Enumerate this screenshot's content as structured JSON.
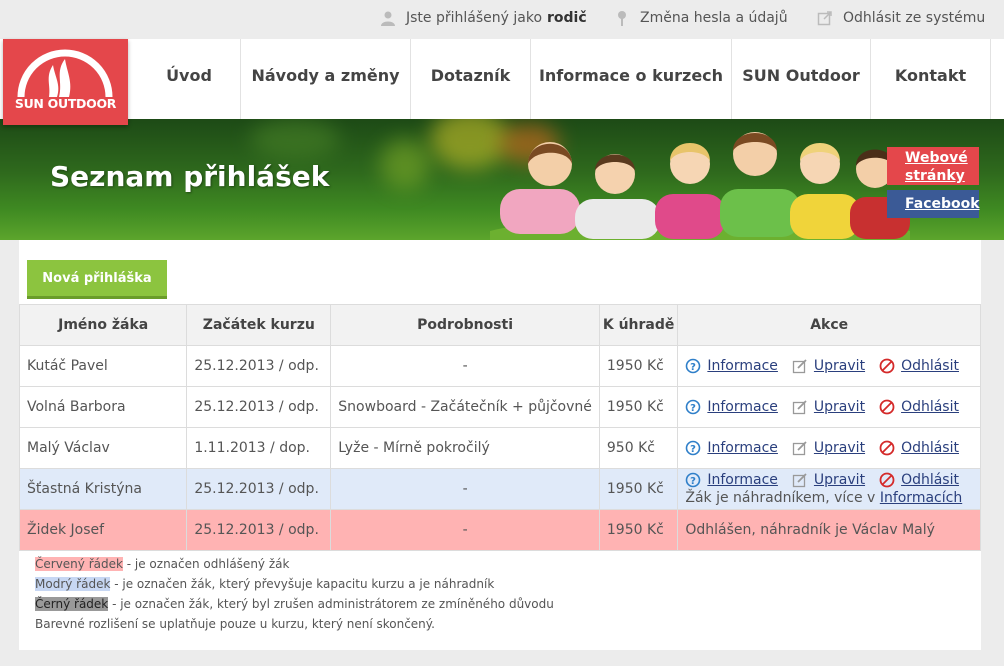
{
  "userbar": {
    "logged_as": "Jste přihlášený jako",
    "role": "rodič",
    "change_pw": "Změna hesla a údajů",
    "logout": "Odhlásit ze systému"
  },
  "logo": {
    "text": "SUN OUTDOOR"
  },
  "menu": [
    {
      "label": "Úvod"
    },
    {
      "label": "Návody a změny"
    },
    {
      "label": "Dotazník"
    },
    {
      "label": "Informace o kurzech"
    },
    {
      "label": "SUN Outdoor"
    },
    {
      "label": "Kontakt"
    }
  ],
  "banner": {
    "title": "Seznam přihlášek",
    "web_link": "Webové stránky",
    "fb_link": "Facebook"
  },
  "new_button": "Nová přihláška",
  "table": {
    "headers": [
      "Jméno žáka",
      "Začátek kurzu",
      "Podrobnosti",
      "K úhradě",
      "Akce"
    ],
    "rows": [
      {
        "name": "Kutáč Pavel",
        "start": "25.12.2013 / odp.",
        "details": "-",
        "due": "1950 Kč"
      },
      {
        "name": "Volná Barbora",
        "start": "25.12.2013 / odp.",
        "details": "Snowboard - Začátečník + půjčovné",
        "due": "1950 Kč"
      },
      {
        "name": "Malý Václav",
        "start": "1.11.2013 / dop.",
        "details": "Lyže - Mírně pokročilý",
        "due": "950 Kč"
      },
      {
        "name": "Šťastná Kristýna",
        "start": "25.12.2013 / odp.",
        "details": "-",
        "due": "1950 Kč",
        "note": "Žák je náhradníkem, více v",
        "note_link": "Informacích"
      },
      {
        "name": "Židek Josef",
        "start": "25.12.2013 / odp.",
        "details": "-",
        "due": "1950 Kč",
        "status": "Odhlášen, náhradník je Václav Malý"
      }
    ],
    "actions": {
      "info": "Informace",
      "edit": "Upravit",
      "cancel": "Odhlásit"
    }
  },
  "legend": {
    "red_label": "Červený řádek",
    "red_text": " - je označen odhlášený žák",
    "blue_label": "Modrý řádek",
    "blue_text": " - je označen žák, který převyšuje kapacitu kurzu a je náhradník",
    "black_label": "Černý řádek",
    "black_text": " - je označen žák, který byl zrušen administrátorem ze zmíněného důvodu",
    "footer": "Barevné rozlišení se uplatňuje pouze u kurzu, který není skončený."
  },
  "colors": {
    "brand_red": "#e4474b",
    "accent_green": "#8cc43f",
    "facebook_blue": "#3b5a96",
    "row_blue": "#e0eaf9",
    "row_red": "#ffb3b3"
  }
}
